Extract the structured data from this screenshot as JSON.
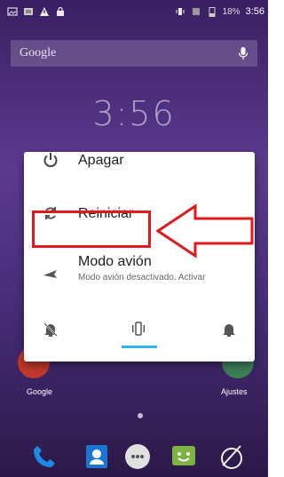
{
  "status": {
    "battery": "18%",
    "time": "3:56"
  },
  "search": {
    "brand": "Google"
  },
  "clock": {
    "time": "3:56"
  },
  "dialog": {
    "power_off": "Apagar",
    "restart": "Reiniciar",
    "airplane_title": "Modo avión",
    "airplane_sub": "Modo avión desactivado. Activar"
  },
  "home": {
    "left_label": "Google",
    "right_label": "Ajustes"
  },
  "colors": {
    "accent": "#2bb5e8",
    "highlight": "#e01a1a"
  }
}
